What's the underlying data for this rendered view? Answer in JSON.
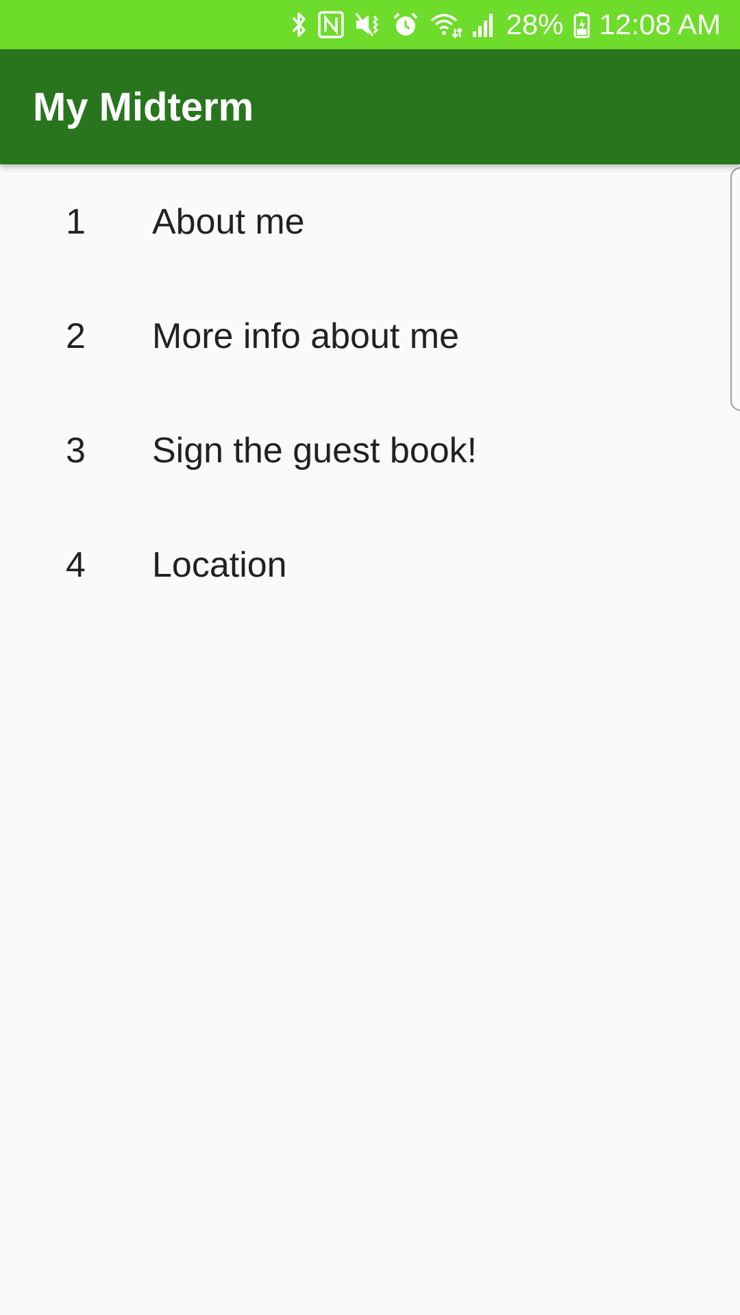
{
  "status_bar": {
    "battery_percent": "28%",
    "time": "12:08 AM",
    "icons": [
      "bluetooth-icon",
      "nfc-icon",
      "vibrate-icon",
      "alarm-icon",
      "wifi-icon",
      "signal-icon",
      "battery-icon"
    ]
  },
  "colors": {
    "status_bar": "#6edc2a",
    "app_bar": "#28751e",
    "background": "#fafafa",
    "text": "#212121"
  },
  "app_bar": {
    "title": "My Midterm"
  },
  "list": {
    "items": [
      {
        "number": "1",
        "label": "About me"
      },
      {
        "number": "2",
        "label": "More info about me"
      },
      {
        "number": "3",
        "label": "Sign the guest book!"
      },
      {
        "number": "4",
        "label": "Location"
      }
    ]
  }
}
